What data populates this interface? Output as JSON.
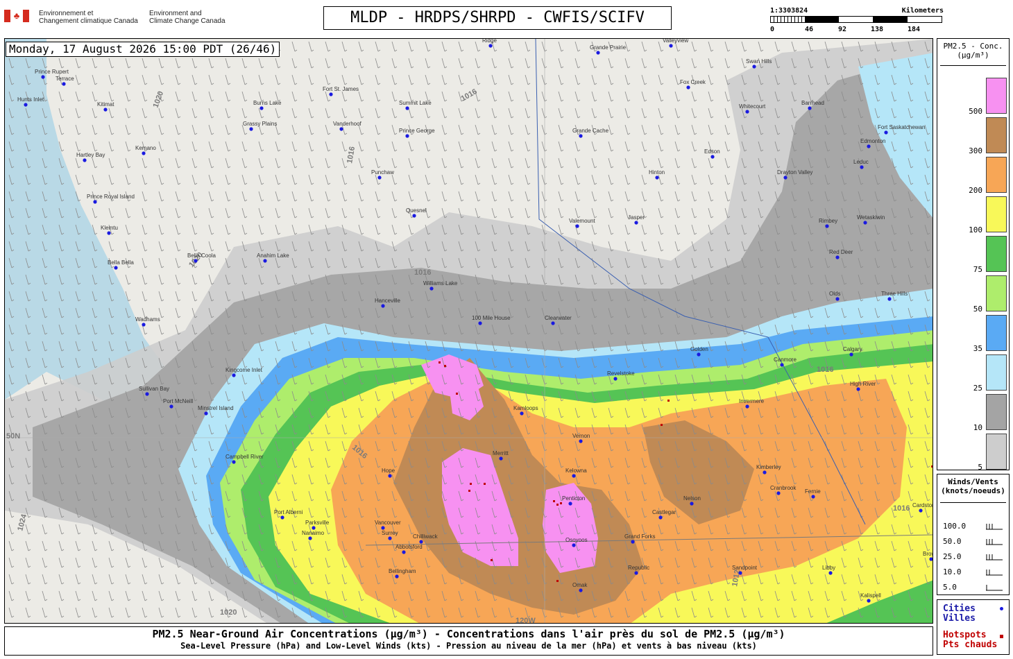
{
  "header": {
    "dept_fr_line1": "Environnement et",
    "dept_fr_line2": "Changement climatique Canada",
    "dept_en_line1": "Environment and",
    "dept_en_line2": "Climate Change Canada",
    "title": "MLDP - HRDPS/SHRPD - CWFIS/SCIFV"
  },
  "scalebar": {
    "ratio": "1:3303824",
    "units": "Kilometers",
    "ticks": [
      "0",
      "46",
      "92",
      "138",
      "184"
    ]
  },
  "map": {
    "datetime": "Monday, 17 August 2026 15:00 PDT (26/46)",
    "graticule_labels": [
      "50N",
      "120W"
    ],
    "isobars": [
      "1016",
      "1020",
      "1012",
      "1024"
    ],
    "cities": [
      "Prince Rupert",
      "Terrace",
      "Hunts Inlet",
      "Kitimat",
      "Hartley Bay",
      "Kemano",
      "Prince Royal Island",
      "Klemtu",
      "Bella Bella",
      "Bella Coola",
      "Wadhams",
      "Port McNeill",
      "Sullivan Bay",
      "Minstrel Island",
      "Kingcome Inlet",
      "Campbell River",
      "Port Alberni",
      "Parksville",
      "Nanaimo",
      "Vancouver",
      "Surrey",
      "Bellingham",
      "Chilliwack",
      "Abbotsford",
      "Hope",
      "Fort St. James",
      "Burns Lake",
      "Grassy Plains",
      "Vanderhoof",
      "Summit Lake",
      "Prince George",
      "Punchaw",
      "Quesnel",
      "Anahim Lake",
      "Williams Lake",
      "100 Mile House",
      "Hanceville",
      "Clearwater",
      "Kamloops",
      "Merritt",
      "Kelowna",
      "Penticton",
      "Osoyoos",
      "Vernon",
      "Revelstoke",
      "Nelson",
      "Castlegar",
      "Grand Forks",
      "Cranbrook",
      "Kimberley",
      "Fernie",
      "Golden",
      "Invermere",
      "Calgary",
      "High River",
      "Edmonton",
      "Edson",
      "Hinton",
      "Jasper",
      "Valemount",
      "Grande Cache",
      "Grande Prairie",
      "Valleyview",
      "Swan Hills",
      "Fox Creek",
      "Whitecourt",
      "Barrhead",
      "Fort Saskatchewan",
      "Leduc",
      "Wetaskiwin",
      "Drayton Valley",
      "Rimbey",
      "Red Deer",
      "Olds",
      "Three Hills",
      "Canmore",
      "Omak",
      "Republic",
      "Sandpoint",
      "Libby",
      "Kalispell",
      "Browning",
      "Cardston",
      "Ridge"
    ]
  },
  "legend_conc": {
    "title_line1": "PM2.5 - Conc.",
    "title_line2": "(µg/m³)",
    "levels": [
      {
        "label": "500",
        "color": "#f791f1"
      },
      {
        "label": "300",
        "color": "#c08a55"
      },
      {
        "label": "200",
        "color": "#f7a656"
      },
      {
        "label": "100",
        "color": "#f8f859"
      },
      {
        "label": "75",
        "color": "#55c455"
      },
      {
        "label": "50",
        "color": "#aeed6c"
      },
      {
        "label": "35",
        "color": "#5aaaf4"
      },
      {
        "label": "25",
        "color": "#b5e6f8"
      },
      {
        "label": "10",
        "color": "#a4a4a4"
      },
      {
        "label": "5",
        "color": "#cdcdcd"
      }
    ]
  },
  "legend_winds": {
    "title_line1": "Winds/Vents",
    "title_line2": "(knots/noeuds)",
    "speeds": [
      "100.0",
      "50.0",
      "25.0",
      "10.0",
      "5.0"
    ]
  },
  "legend_cities": {
    "cities_en": "Cities",
    "cities_fr": "Villes",
    "hotspots_en": "Hotspots",
    "hotspots_fr": "Pts chauds"
  },
  "footer": {
    "line1": "PM2.5 Near-Ground Air Concentrations (µg/m³) - Concentrations dans l'air près du sol de PM2.5 (µg/m³)",
    "line2": "Sea-Level Pressure (hPa) and Low-Level Winds (kts) - Pression au niveau de la mer (hPa) et vents à bas niveau (kts)"
  }
}
